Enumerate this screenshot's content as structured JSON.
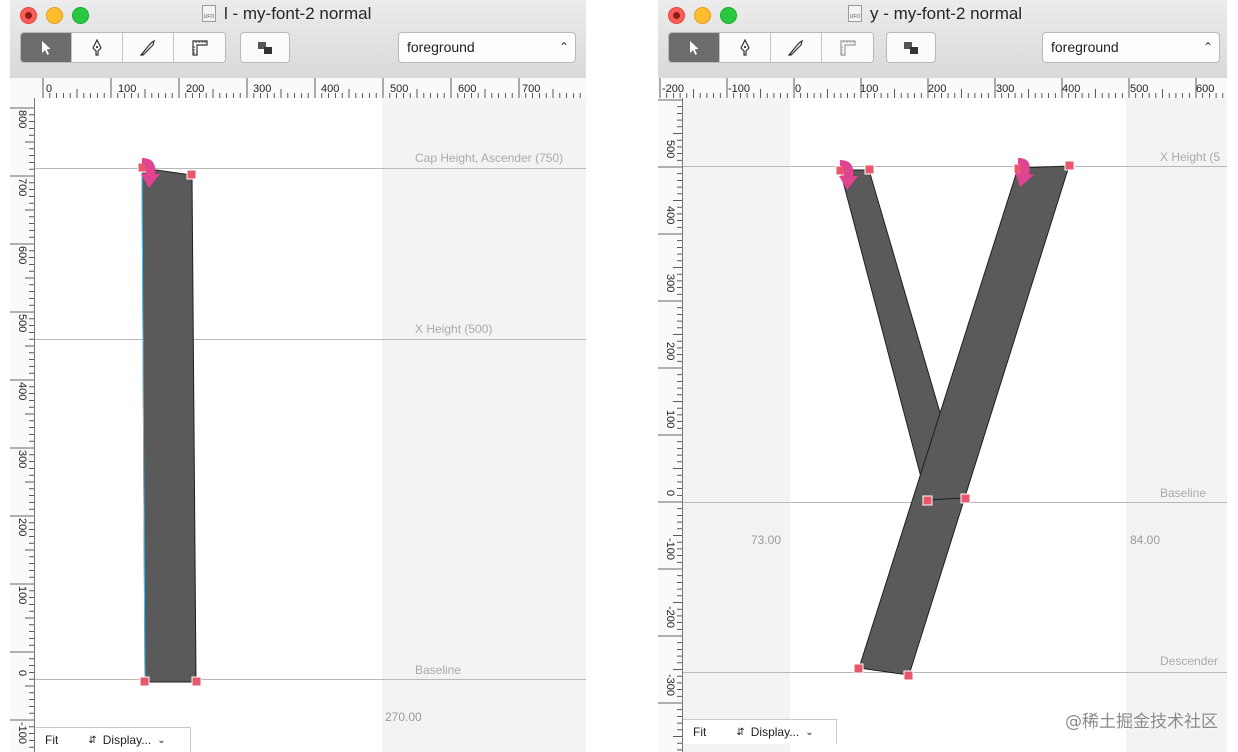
{
  "windows": [
    {
      "title": "l - my-font-2 normal",
      "layer_select": "foreground",
      "ruler_h": [
        "0",
        "100",
        "200",
        "300",
        "400",
        "500",
        "600",
        "700"
      ],
      "ruler_v": [
        "800",
        "700",
        "600",
        "500",
        "400",
        "300",
        "200",
        "100",
        "0",
        "-100"
      ],
      "guides": [
        {
          "label": "Cap Height, Ascender (750)"
        },
        {
          "label": "X Height (500)"
        },
        {
          "label": "Baseline"
        }
      ],
      "metrics": [
        "270.00"
      ],
      "status": {
        "zoom": "Fit",
        "display": "Display..."
      }
    },
    {
      "title": "y - my-font-2 normal",
      "layer_select": "foreground",
      "ruler_h": [
        "-200",
        "-100",
        "0",
        "100",
        "200",
        "300",
        "400",
        "500",
        "600"
      ],
      "ruler_v": [
        "500",
        "400",
        "300",
        "200",
        "100",
        "0",
        "-100",
        "-200",
        "-300"
      ],
      "guides": [
        {
          "label": "X Height (5"
        },
        {
          "label": "Baseline"
        },
        {
          "label": "Descender"
        }
      ],
      "metrics": [
        "73.00",
        "84.00"
      ],
      "status": {
        "zoom": "Fit",
        "display": "Display..."
      }
    }
  ],
  "watermark": "@稀土掘金技术社区",
  "colors": {
    "glyph_fill": "#5a5a5a",
    "point": "#e8576b",
    "arrow": "#e0438f",
    "guide": "#b8b8b8"
  }
}
